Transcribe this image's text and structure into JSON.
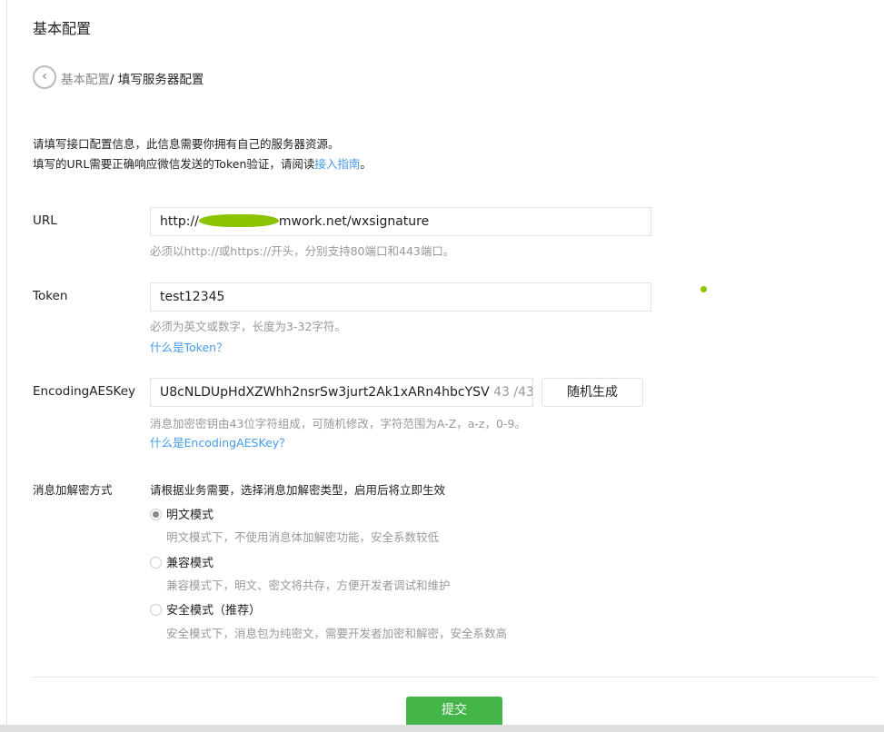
{
  "page_title": "基本配置",
  "breadcrumb": {
    "parent": "基本配置",
    "separator": "/ ",
    "current": "填写服务器配置"
  },
  "intro": {
    "line1": "请填写接口配置信息，此信息需要你拥有自己的服务器资源。",
    "line2_prefix": "填写的URL需要正确响应微信发送的Token验证，请阅读",
    "line2_link": "接入指南",
    "line2_suffix": "。"
  },
  "url": {
    "label": "URL",
    "value_prefix": "http://",
    "value_suffix": "mwork.net/wxsignature",
    "hint": "必须以http://或https://开头，分别支持80端口和443端口。"
  },
  "token": {
    "label": "Token",
    "value": "test12345",
    "hint": "必须为英文或数字，长度为3-32字符。",
    "help_link": "什么是Token？"
  },
  "aeskey": {
    "label": "EncodingAESKey",
    "value": "U8cNLDUpHdXZWhh2nsrSw3jurt2Ak1xARn4hbcYSV",
    "counter": "43 /43",
    "generate_button": "随机生成",
    "hint": "消息加密密钥由43位字符组成，可随机修改，字符范围为A-Z，a-z，0-9。",
    "help_link": "什么是EncodingAESKey？"
  },
  "encryption": {
    "label": "消息加解密方式",
    "intro": "请根据业务需要，选择消息加解密类型，启用后将立即生效",
    "options": [
      {
        "label": "明文模式",
        "desc": "明文模式下，不使用消息体加解密功能，安全系数较低",
        "selected": true
      },
      {
        "label": "兼容模式",
        "desc": "兼容模式下，明文、密文将共存，方便开发者调试和维护",
        "selected": false
      },
      {
        "label": "安全模式（推荐）",
        "desc": "安全模式下，消息包为纯密文，需要开发者加密和解密，安全系数高",
        "selected": false
      }
    ]
  },
  "submit_label": "提交",
  "colors": {
    "primary": "#44b549",
    "link": "#459ae9"
  }
}
